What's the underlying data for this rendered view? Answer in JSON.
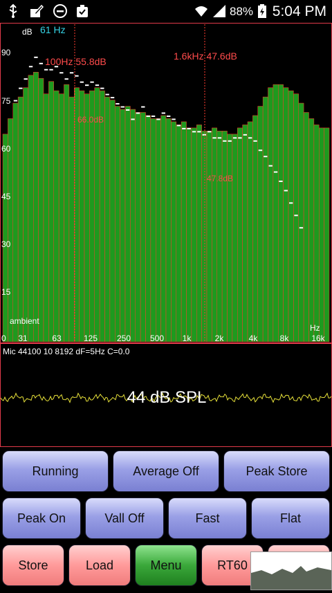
{
  "statusbar": {
    "battery": "88%",
    "time": "5:04 PM"
  },
  "analyzer": {
    "db_unit": "dB",
    "freq_readout": "61 Hz",
    "peak_left": "100Hz  55.8dB",
    "peak_right": "1.6kHz  47.6dB",
    "marker_left": "66.0dB",
    "marker_right": "47.8dB",
    "ambient": "ambient",
    "hz_unit": "Hz",
    "y_ticks": [
      "90",
      "75",
      "60",
      "45",
      "30",
      "15",
      "0"
    ],
    "x_ticks": [
      "31",
      "63",
      "125",
      "250",
      "500",
      "1k",
      "2k",
      "4k",
      "8k",
      "16k"
    ],
    "colors": {
      "bars": "#1e9a1e",
      "bar_edge": "#ff3b30",
      "peak": "#ffffff",
      "cursor": "#ff3b30"
    }
  },
  "waveform": {
    "info": "Mic 44100 10 8192 dF=5Hz C=0.0",
    "spl": "44 dB SPL"
  },
  "buttons": {
    "running": "Running",
    "average_off": "Average Off",
    "peak_store": "Peak Store",
    "peak_on": "Peak On",
    "vall_off": "Vall Off",
    "fast": "Fast",
    "flat": "Flat",
    "store": "Store",
    "load": "Load",
    "menu": "Menu",
    "rt60": "RT60"
  }
}
